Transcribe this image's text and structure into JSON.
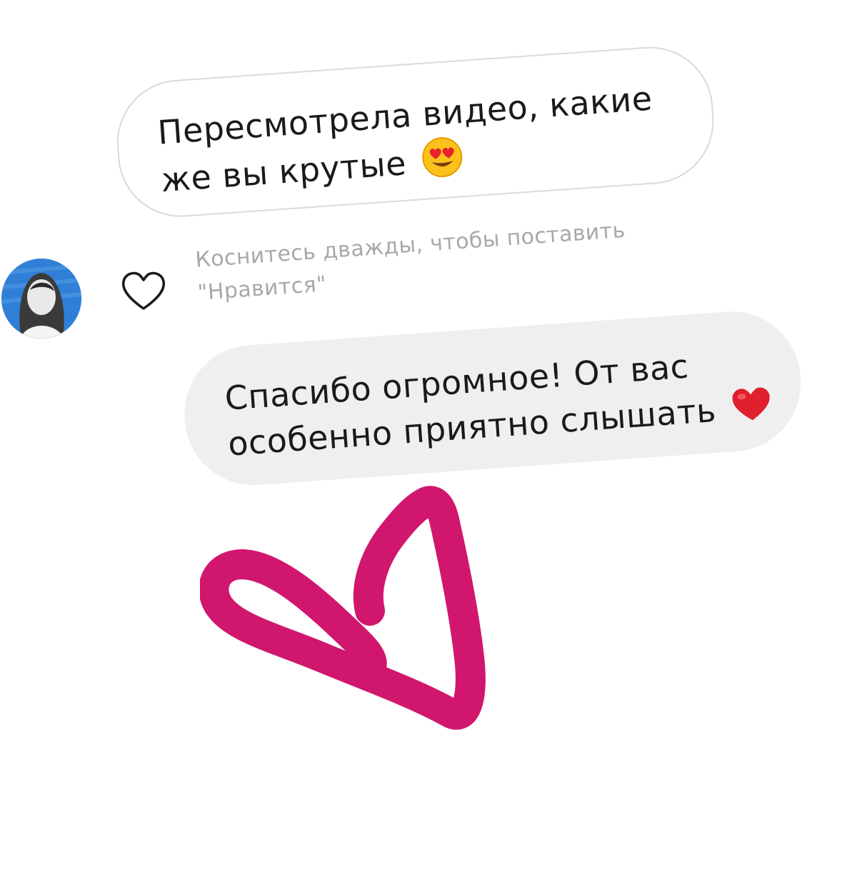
{
  "incoming_message": {
    "text": "Пересмотрела видео, какие же вы крутые",
    "emoji": "smiling-face-with-heart-eyes"
  },
  "like_hint": {
    "text": "Коснитесь дважды, чтобы поставить \"Нравится\""
  },
  "reply_message": {
    "text": "Спасибо огромное! От вас особенно приятно слышать",
    "emoji": "red-heart"
  },
  "colors": {
    "bubble_outline": "#d9d9d9",
    "reply_bubble": "#efefef",
    "hint_text": "#a8a8a8",
    "doodle_heart": "#d1166d",
    "avatar_background": "#2f7fd6"
  }
}
